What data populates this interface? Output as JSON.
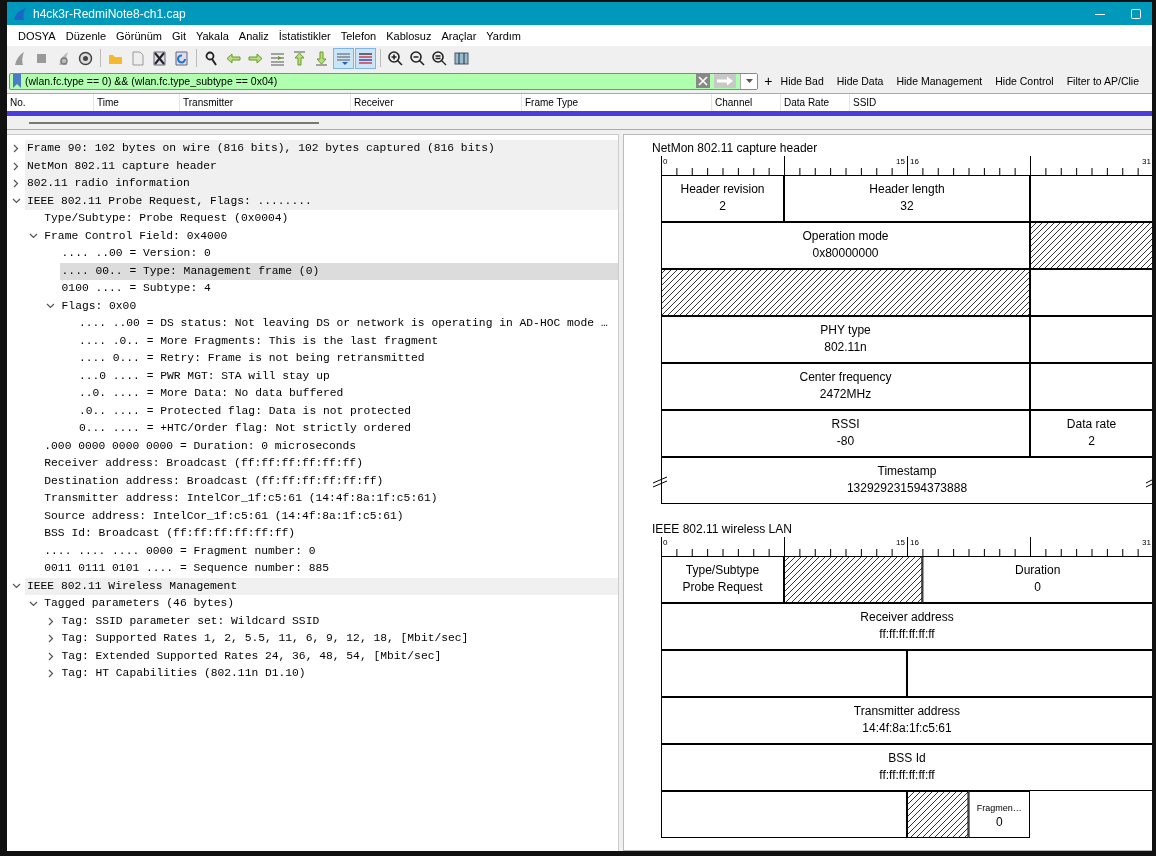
{
  "window": {
    "title": "h4ck3r-RedmiNote8-ch1.cap"
  },
  "menu": [
    "DOSYA",
    "Düzenle",
    "Görünüm",
    "Git",
    "Yakala",
    "Analiz",
    "İstatistikler",
    "Telefon",
    "Kablosuz",
    "Araçlar",
    "Yardım"
  ],
  "toolbar": [
    {
      "kind": "fin",
      "pressed": false
    },
    {
      "kind": "stop",
      "pressed": false
    },
    {
      "kind": "restart",
      "pressed": false
    },
    {
      "kind": "options",
      "pressed": false
    },
    {
      "kind": "separator"
    },
    {
      "kind": "folder",
      "pressed": false
    },
    {
      "kind": "file",
      "pressed": false
    },
    {
      "kind": "close",
      "pressed": false
    },
    {
      "kind": "reload",
      "pressed": false
    },
    {
      "kind": "separator"
    },
    {
      "kind": "find",
      "pressed": false
    },
    {
      "kind": "back",
      "pressed": false
    },
    {
      "kind": "forward",
      "pressed": false
    },
    {
      "kind": "goto",
      "pressed": false
    },
    {
      "kind": "first",
      "pressed": false
    },
    {
      "kind": "last",
      "pressed": false
    },
    {
      "kind": "autoscroll",
      "pressed": true
    },
    {
      "kind": "colorize",
      "pressed": true
    },
    {
      "kind": "separator"
    },
    {
      "kind": "zoom_in",
      "pressed": false
    },
    {
      "kind": "zoom_out",
      "pressed": false
    },
    {
      "kind": "zoom_reset",
      "pressed": false
    },
    {
      "kind": "resize",
      "pressed": false
    }
  ],
  "filter": {
    "value": "(wlan.fc.type == 0) && (wlan.fc.type_subtype == 0x04)",
    "add": "+",
    "buttons": [
      "Hide Bad",
      "Hide Data",
      "Hide Management",
      "Hide Control",
      "Filter to AP/Clie"
    ]
  },
  "packet_list": {
    "columns": [
      "No.",
      "Time",
      "Transmitter",
      "Receiver",
      "Frame Type",
      "Channel",
      "Data Rate",
      "SSID"
    ],
    "rows": [
      {
        "selected": true
      }
    ]
  },
  "tree": [
    {
      "label": "Frame 90: 102 bytes on wire (816 bits), 102 bytes captured (816 bits)",
      "expanded": false,
      "selected": false
    },
    {
      "label": "NetMon 802.11 capture header",
      "expanded": false,
      "selected": false
    },
    {
      "label": "802.11 radio information",
      "expanded": false,
      "selected": false
    },
    {
      "label": "IEEE 802.11 Probe Request, Flags: ........",
      "expanded": true,
      "selected": false,
      "children": [
        {
          "label": "Type/Subtype: Probe Request (0x0004)",
          "selected": false
        },
        {
          "label": "Frame Control Field: 0x4000",
          "expanded": true,
          "selected": false,
          "children": [
            {
              "label": ".... ..00 = Version: 0",
              "selected": false
            },
            {
              "label": ".... 00.. = Type: Management frame (0)",
              "selected": true
            },
            {
              "label": "0100 .... = Subtype: 4",
              "selected": false
            },
            {
              "label": "Flags: 0x00",
              "expanded": true,
              "selected": false,
              "children": [
                {
                  "label": ".... ..00 = DS status: Not leaving DS or network is operating in AD-HOC mode …",
                  "selected": false
                },
                {
                  "label": ".... .0.. = More Fragments: This is the last fragment",
                  "selected": false
                },
                {
                  "label": ".... 0... = Retry: Frame is not being retransmitted",
                  "selected": false
                },
                {
                  "label": "...0 .... = PWR MGT: STA will stay up",
                  "selected": false
                },
                {
                  "label": "..0. .... = More Data: No data buffered",
                  "selected": false
                },
                {
                  "label": ".0.. .... = Protected flag: Data is not protected",
                  "selected": false
                },
                {
                  "label": "0... .... = +HTC/Order flag: Not strictly ordered",
                  "selected": false
                }
              ]
            }
          ]
        },
        {
          "label": ".000 0000 0000 0000 = Duration: 0 microseconds",
          "selected": false
        },
        {
          "label": "Receiver address: Broadcast (ff:ff:ff:ff:ff:ff)",
          "selected": false
        },
        {
          "label": "Destination address: Broadcast (ff:ff:ff:ff:ff:ff)",
          "selected": false
        },
        {
          "label": "Transmitter address: IntelCor_1f:c5:61 (14:4f:8a:1f:c5:61)",
          "selected": false
        },
        {
          "label": "Source address: IntelCor_1f:c5:61 (14:4f:8a:1f:c5:61)",
          "selected": false
        },
        {
          "label": "BSS Id: Broadcast (ff:ff:ff:ff:ff:ff)",
          "selected": false
        },
        {
          "label": ".... .... .... 0000 = Fragment number: 0",
          "selected": false
        },
        {
          "label": "0011 0111 0101 .... = Sequence number: 885",
          "selected": false
        }
      ]
    },
    {
      "label": "IEEE 802.11 Wireless Management",
      "expanded": true,
      "selected": false,
      "children": [
        {
          "label": "Tagged parameters (46 bytes)",
          "expanded": true,
          "selected": false,
          "children": [
            {
              "label": "Tag: SSID parameter set: Wildcard SSID",
              "expanded": false,
              "selected": false
            },
            {
              "label": "Tag: Supported Rates 1, 2, 5.5, 11, 6, 9, 12, 18, [Mbit/sec]",
              "expanded": false,
              "selected": false
            },
            {
              "label": "Tag: Extended Supported Rates 24, 36, 48, 54, [Mbit/sec]",
              "expanded": false,
              "selected": false
            },
            {
              "label": "Tag: HT Capabilities (802.11n D1.10)",
              "expanded": false,
              "selected": false
            }
          ]
        }
      ]
    }
  ],
  "diagrams": [
    {
      "title": "NetMon 802.11 capture header",
      "ruler": [
        "0",
        "15",
        "16",
        "31"
      ],
      "rows": [
        [
          {
            "kind": "field",
            "label": "Header revision",
            "value": "2"
          },
          {
            "kind": "field",
            "label": "Header length",
            "value": "32"
          },
          {
            "kind": "blank"
          }
        ],
        [
          {
            "kind": "field",
            "label": "Operation mode",
            "value": "0x80000000"
          },
          {
            "kind": "hatched"
          }
        ],
        [
          {
            "kind": "hatched"
          },
          {
            "kind": "blank"
          }
        ],
        [
          {
            "kind": "field",
            "label": "PHY type",
            "value": "802.11n"
          },
          {
            "kind": "blank"
          }
        ],
        [
          {
            "kind": "field",
            "label": "Center frequency",
            "value": "2472MHz"
          },
          {
            "kind": "blank"
          }
        ],
        [
          {
            "kind": "field",
            "label": "RSSI",
            "value": "-80"
          },
          {
            "kind": "field",
            "label": "Data rate",
            "value": "2"
          }
        ],
        [
          {
            "kind": "split_field",
            "label": "Timestamp",
            "value": "132929231594373888"
          }
        ]
      ]
    },
    {
      "title": "IEEE 802.11 wireless LAN",
      "ruler": [
        "0",
        "15",
        "16",
        "31"
      ],
      "rows": [
        [
          {
            "kind": "field",
            "label": "Type/Subtype",
            "value": "Probe Request"
          },
          {
            "kind": "hatched"
          },
          {
            "kind": "field",
            "label": "Duration",
            "value": "0"
          }
        ],
        [
          {
            "kind": "field",
            "label": "Receiver address",
            "value": "ff:ff:ff:ff:ff:ff"
          }
        ],
        [
          {
            "kind": "blank"
          },
          {
            "kind": "blank"
          }
        ],
        [
          {
            "kind": "field",
            "label": "Transmitter address",
            "value": "14:4f:8a:1f:c5:61"
          }
        ],
        [
          {
            "kind": "field",
            "label": "BSS Id",
            "value": "ff:ff:ff:ff:ff:ff"
          }
        ],
        [
          {
            "kind": "blank"
          },
          {
            "kind": "hatched"
          },
          {
            "kind": "narrow_field",
            "label": "Fragmen…",
            "value": "0"
          }
        ]
      ]
    }
  ]
}
